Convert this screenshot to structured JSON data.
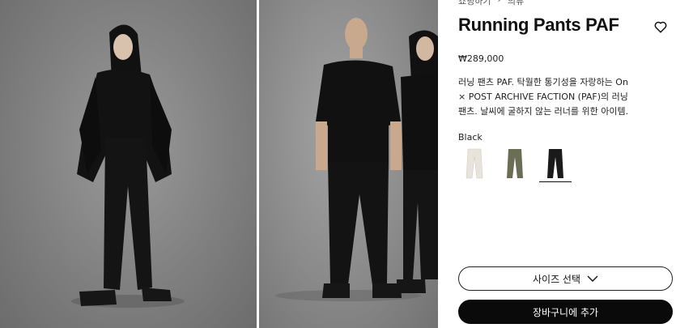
{
  "breadcrumb": {
    "items": [
      "쇼핑하기",
      "의류"
    ],
    "separator": "›"
  },
  "product": {
    "title": "Running Pants PAF",
    "price": "₩289,000",
    "description": "러닝 팬츠 PAF. 탁월한 통기성을 자랑하는 On × POST ARCHIVE FACTION (PAF)의 러닝 팬츠. 날씨에 굴하지 않는 러너를 위한 아이템."
  },
  "color": {
    "selected_label": "Black",
    "swatches": [
      {
        "name": "cream",
        "color": "#e8e4dc",
        "selected": false
      },
      {
        "name": "olive",
        "color": "#6b6d55",
        "selected": false
      },
      {
        "name": "black",
        "color": "#1a1a1a",
        "selected": true
      }
    ]
  },
  "actions": {
    "size_select_label": "사이즈 선택",
    "add_to_cart_label": "장바구니에 추가"
  },
  "icons": {
    "wishlist": "heart-icon",
    "size_dropdown": "chevron-down-icon"
  },
  "colors": {
    "primary_button": "#0a0a0a",
    "text": "#111111"
  }
}
